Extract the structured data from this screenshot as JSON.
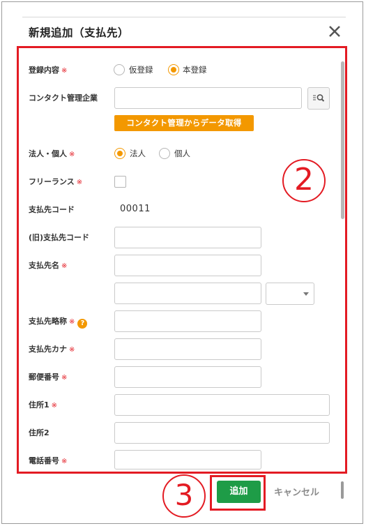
{
  "dialog": {
    "title": "新規追加（支払先）",
    "close_icon": "close-icon",
    "add_label": "追加",
    "cancel_label": "キャンセル"
  },
  "form": {
    "registration": {
      "label": "登録内容",
      "required": "※",
      "options": [
        "仮登録",
        "本登録"
      ],
      "selected": "本登録"
    },
    "contact_company": {
      "label": "コンタクト管理企業",
      "value": "",
      "search_icon": "list-search-icon",
      "fetch_button": "コンタクト管理からデータ取得"
    },
    "entity_type": {
      "label": "法人・個人",
      "required": "※",
      "options": [
        "法人",
        "個人"
      ],
      "selected": "法人"
    },
    "freelance": {
      "label": "フリーランス",
      "required": "※",
      "checked": false
    },
    "payee_code": {
      "label": "支払先コード",
      "value": "00011"
    },
    "old_payee_code": {
      "label": "(旧)支払先コード",
      "value": ""
    },
    "payee_name": {
      "label": "支払先名",
      "required": "※",
      "value": "",
      "value2": "",
      "select_value": ""
    },
    "payee_short": {
      "label": "支払先略称",
      "required": "※",
      "help_icon": "question-icon",
      "help_text": "?",
      "value": ""
    },
    "payee_kana": {
      "label": "支払先カナ",
      "required": "※",
      "value": ""
    },
    "postal_code": {
      "label": "郵便番号",
      "required": "※",
      "value": ""
    },
    "address1": {
      "label": "住所1",
      "required": "※",
      "value": ""
    },
    "address2": {
      "label": "住所2",
      "value": ""
    },
    "phone": {
      "label": "電話番号",
      "required": "※",
      "value": ""
    }
  },
  "annotations": {
    "step2": "2",
    "step3": "3"
  },
  "colors": {
    "accent_orange": "#f39800",
    "add_green": "#1e9c47",
    "annotation_red": "#e31b23"
  }
}
